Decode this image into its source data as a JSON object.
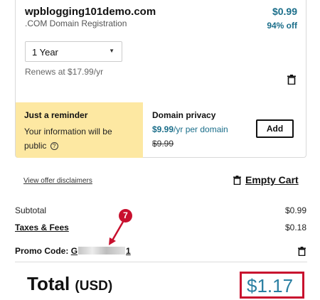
{
  "item": {
    "domain_name": "wpblogging101demo.com",
    "domain_type": ".COM Domain Registration",
    "price": "$0.99",
    "discount": "94% off",
    "term": "1 Year",
    "renews": "Renews at $17.99/yr"
  },
  "reminder": {
    "title": "Just a reminder",
    "text": "Your information will be public",
    "help_icon": "?"
  },
  "privacy": {
    "title": "Domain privacy",
    "price": "$9.99",
    "price_suffix": "/yr per domain",
    "old_price": "$9.99",
    "add_label": "Add"
  },
  "links": {
    "disclaimers": "View offer disclaimers",
    "empty_cart": "Empty Cart"
  },
  "summary": {
    "subtotal_label": "Subtotal",
    "subtotal_value": "$0.99",
    "taxes_label": "Taxes & Fees",
    "taxes_value": "$0.18",
    "promo_label": "Promo Code:",
    "promo_prefix": "G",
    "promo_suffix": "1"
  },
  "total": {
    "label": "Total",
    "currency": "(USD)",
    "value": "$1.17"
  },
  "annotation": {
    "step": "7"
  },
  "colors": {
    "accent": "#1b6e8a",
    "reminder_bg": "#fde8a2",
    "highlight": "#c8102e"
  }
}
